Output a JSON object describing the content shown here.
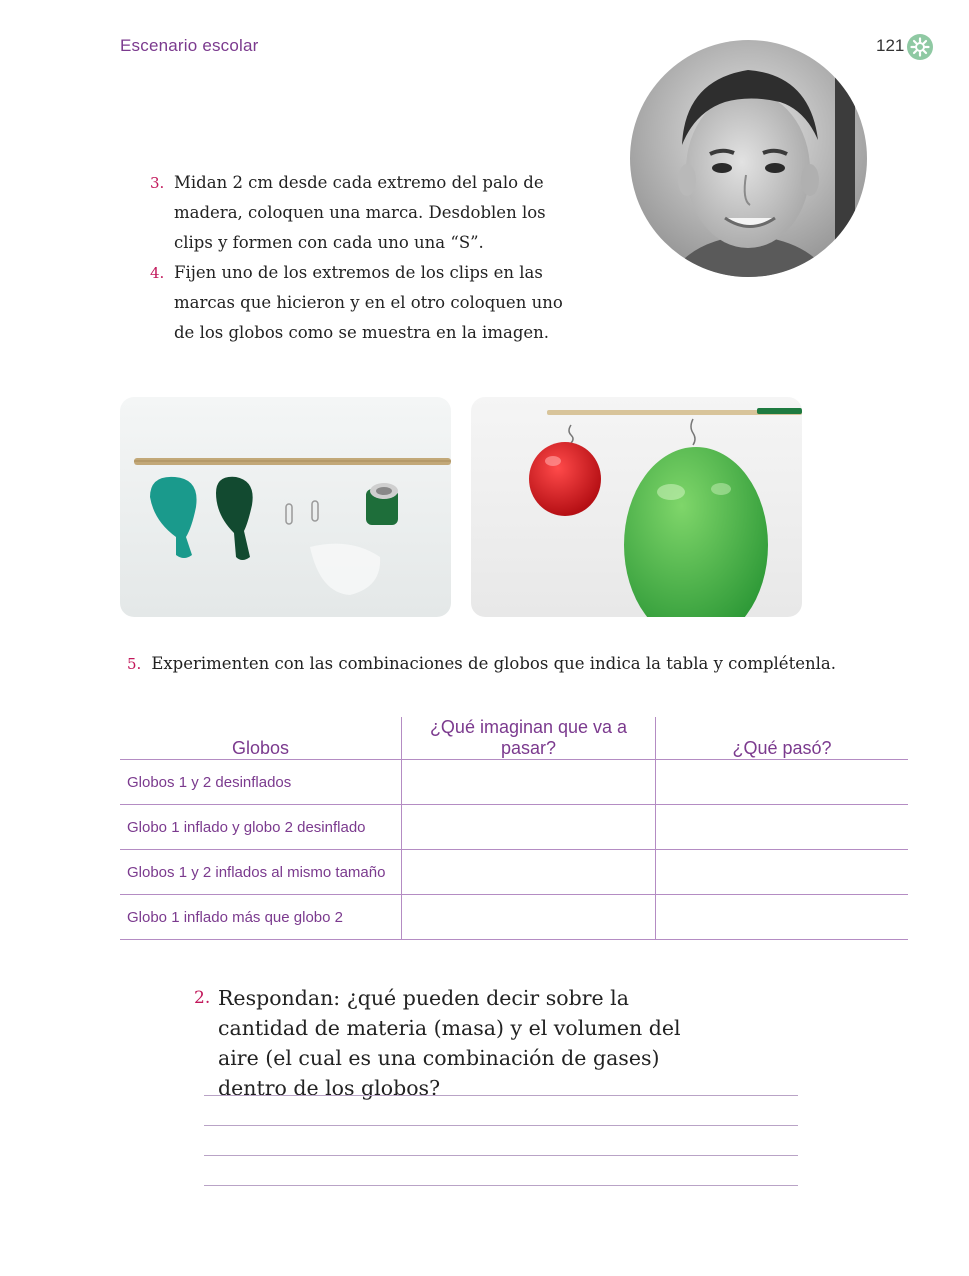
{
  "header": {
    "section_title": "Escenario escolar",
    "page_number": "121"
  },
  "instructions": [
    {
      "num": "3.",
      "text": "Midan 2 cm desde cada extremo del palo de madera, coloquen una marca. Desdoblen los clips y formen con cada uno una “S”."
    },
    {
      "num": "4.",
      "text": "Fijen uno de los extremos de los clips en las marcas que hicieron y en el otro coloquen uno de los globos como se muestra en la imagen."
    }
  ],
  "step5": {
    "num": "5.",
    "text": "Experimenten con las combinaciones de globos que indica la tabla y complétenla."
  },
  "table": {
    "headers": [
      "Globos",
      "¿Qué imaginan que va a pasar?",
      "¿Qué pasó?"
    ],
    "rows": [
      [
        "Globos 1 y 2 desinflados",
        "",
        ""
      ],
      [
        "Globo 1 inflado y globo 2 desinflado",
        "",
        ""
      ],
      [
        "Globos 1 y 2 inflados al mismo tamaño",
        "",
        ""
      ],
      [
        "Globo 1 inflado más que globo 2",
        "",
        ""
      ]
    ]
  },
  "question2": {
    "num": "2.",
    "text": "Respondan: ¿qué pueden decir sobre la cantidad de materia (masa) y el volumen del aire (el cual es una combinación de gases) dentro de los globos?"
  },
  "colors": {
    "accent_purple": "#7b3a8e",
    "number_magenta": "#c2185b",
    "rule_lilac": "#b48cc3",
    "gear_green": "#8fc9a3"
  },
  "icons": {
    "header_icon": "gear-icon"
  }
}
